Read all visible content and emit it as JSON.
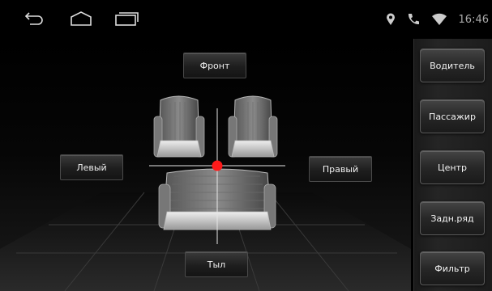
{
  "status": {
    "time": "16:46",
    "icons": [
      "location-icon",
      "phone-icon",
      "wifi-icon"
    ]
  },
  "nav": {
    "icons": [
      "back-icon",
      "home-icon",
      "recent-apps-icon"
    ]
  },
  "zones": {
    "front_label": "Фронт",
    "left_label": "Левый",
    "right_label": "Правый",
    "rear_label": "Тыл"
  },
  "sidebar": {
    "items": [
      {
        "label": "Водитель"
      },
      {
        "label": "Пассажир"
      },
      {
        "label": "Центр"
      },
      {
        "label": "Задн.ряд"
      },
      {
        "label": "Фильтр"
      }
    ]
  },
  "colors": {
    "focus_point": "#ff1a1a",
    "accent": "#ffffff",
    "background": "#000000"
  }
}
